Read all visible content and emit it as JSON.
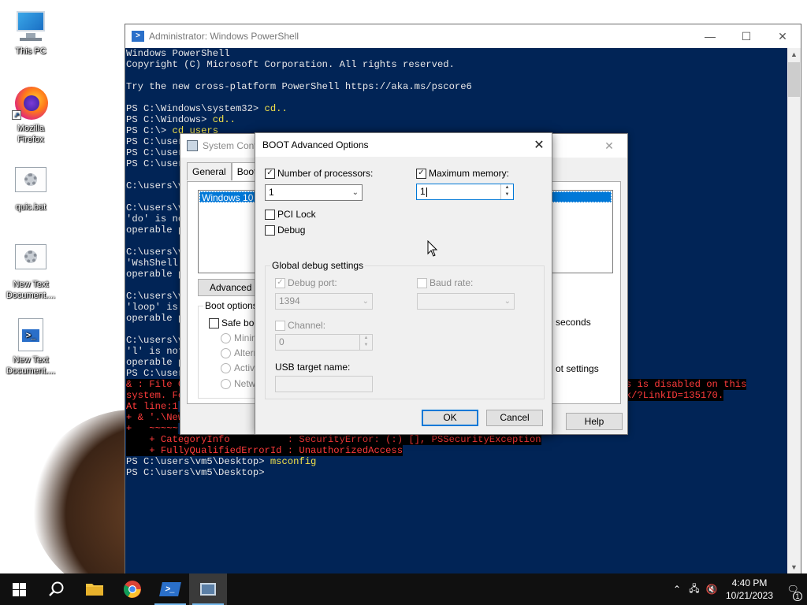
{
  "desktop": {
    "icons": [
      {
        "label": "This PC"
      },
      {
        "label": "Mozilla Firefox"
      },
      {
        "label": "quic.bat"
      },
      {
        "label": "New Text Document...."
      },
      {
        "label": "New Text Document...."
      }
    ]
  },
  "powershell": {
    "title": "Administrator: Windows PowerShell",
    "lines": [
      {
        "text": "Windows PowerShell",
        "kind": "normal"
      },
      {
        "text": "Copyright (C) Microsoft Corporation. All rights reserved.",
        "kind": "normal"
      },
      {
        "text": "",
        "kind": "normal"
      },
      {
        "text": "Try the new cross-platform PowerShell https://aka.ms/pscore6",
        "kind": "normal"
      },
      {
        "text": "",
        "kind": "normal"
      },
      {
        "text": "PS C:\\Windows\\system32> ",
        "cmd": "cd..",
        "kind": "prompt"
      },
      {
        "text": "PS C:\\Windows> ",
        "cmd": "cd..",
        "kind": "prompt"
      },
      {
        "text": "PS C:\\> ",
        "cmd": "cd users",
        "kind": "prompt"
      },
      {
        "text": "PS C:\\user",
        "kind": "normal"
      },
      {
        "text": "PS C:\\user",
        "kind": "normal"
      },
      {
        "text": "PS C:\\user",
        "kind": "normal"
      },
      {
        "text": "",
        "kind": "normal"
      },
      {
        "text": "C:\\users\\v",
        "kind": "normal"
      },
      {
        "text": "",
        "kind": "normal"
      },
      {
        "text": "C:\\users\\v",
        "kind": "normal"
      },
      {
        "text": "'do' is no",
        "kind": "normal"
      },
      {
        "text": "operable p",
        "kind": "normal"
      },
      {
        "text": "",
        "kind": "normal"
      },
      {
        "text": "C:\\users\\v",
        "kind": "normal"
      },
      {
        "text": "'WshShell.",
        "kind": "normal"
      },
      {
        "text": "operable p",
        "kind": "normal"
      },
      {
        "text": "",
        "kind": "normal"
      },
      {
        "text": "C:\\users\\v",
        "kind": "normal"
      },
      {
        "text": "'loop' is",
        "kind": "normal"
      },
      {
        "text": "operable p",
        "kind": "normal"
      },
      {
        "text": "",
        "kind": "normal"
      },
      {
        "text": "C:\\users\\v",
        "kind": "normal"
      },
      {
        "text": "'l' is not",
        "kind": "normal"
      },
      {
        "text": "operable p",
        "kind": "normal"
      },
      {
        "text": "PS C:\\user",
        "kind": "normal"
      },
      {
        "text": "& : File C",
        "tail": "s is disabled on this",
        "kind": "error"
      },
      {
        "text": "system. Fo",
        "tail": "k/?LinkID=135170.",
        "kind": "error"
      },
      {
        "text": "At line:1",
        "kind": "error"
      },
      {
        "text": "+ & '.\\New",
        "kind": "error"
      },
      {
        "text": "+   ~~~~~",
        "kind": "error"
      },
      {
        "text": "    + CategoryInfo          : SecurityError: (:) [], PSSecurityException",
        "kind": "error"
      },
      {
        "text": "    + FullyQualifiedErrorId : UnauthorizedAccess",
        "kind": "error"
      },
      {
        "text": "PS C:\\users\\vm5\\Desktop> ",
        "cmd": "msconfig",
        "kind": "prompt"
      },
      {
        "text": "PS C:\\users\\vm5\\Desktop>",
        "kind": "normal"
      }
    ]
  },
  "sysconfig": {
    "title": "System Conf",
    "tabs": [
      "General",
      "Boot"
    ],
    "os_item": "Windows 10 (C",
    "advanced_button": "Advanced op",
    "boot_options_legend": "Boot options",
    "safe_boot": "Safe boo",
    "radios": [
      "Minima",
      "Altern",
      "Active",
      "Netwo"
    ],
    "seconds_text": "seconds",
    "boot_settings_text": "ot settings",
    "help_button": "Help"
  },
  "boot_dialog": {
    "title": "BOOT Advanced Options",
    "num_processors_label": "Number of processors:",
    "num_processors_value": "1",
    "max_memory_label": "Maximum memory:",
    "max_memory_value": "1",
    "pci_lock_label": "PCI Lock",
    "debug_label": "Debug",
    "global_debug_legend": "Global debug settings",
    "debug_port_label": "Debug port:",
    "debug_port_value": "1394",
    "baud_rate_label": "Baud rate:",
    "channel_label": "Channel:",
    "channel_value": "0",
    "usb_target_label": "USB target name:",
    "ok_button": "OK",
    "cancel_button": "Cancel"
  },
  "taskbar": {
    "time": "4:40 PM",
    "date": "10/21/2023",
    "notification_count": "1",
    "colors": {
      "background": "#101010",
      "active": "#3a3a3a",
      "indicator": "#76b9ed"
    }
  }
}
